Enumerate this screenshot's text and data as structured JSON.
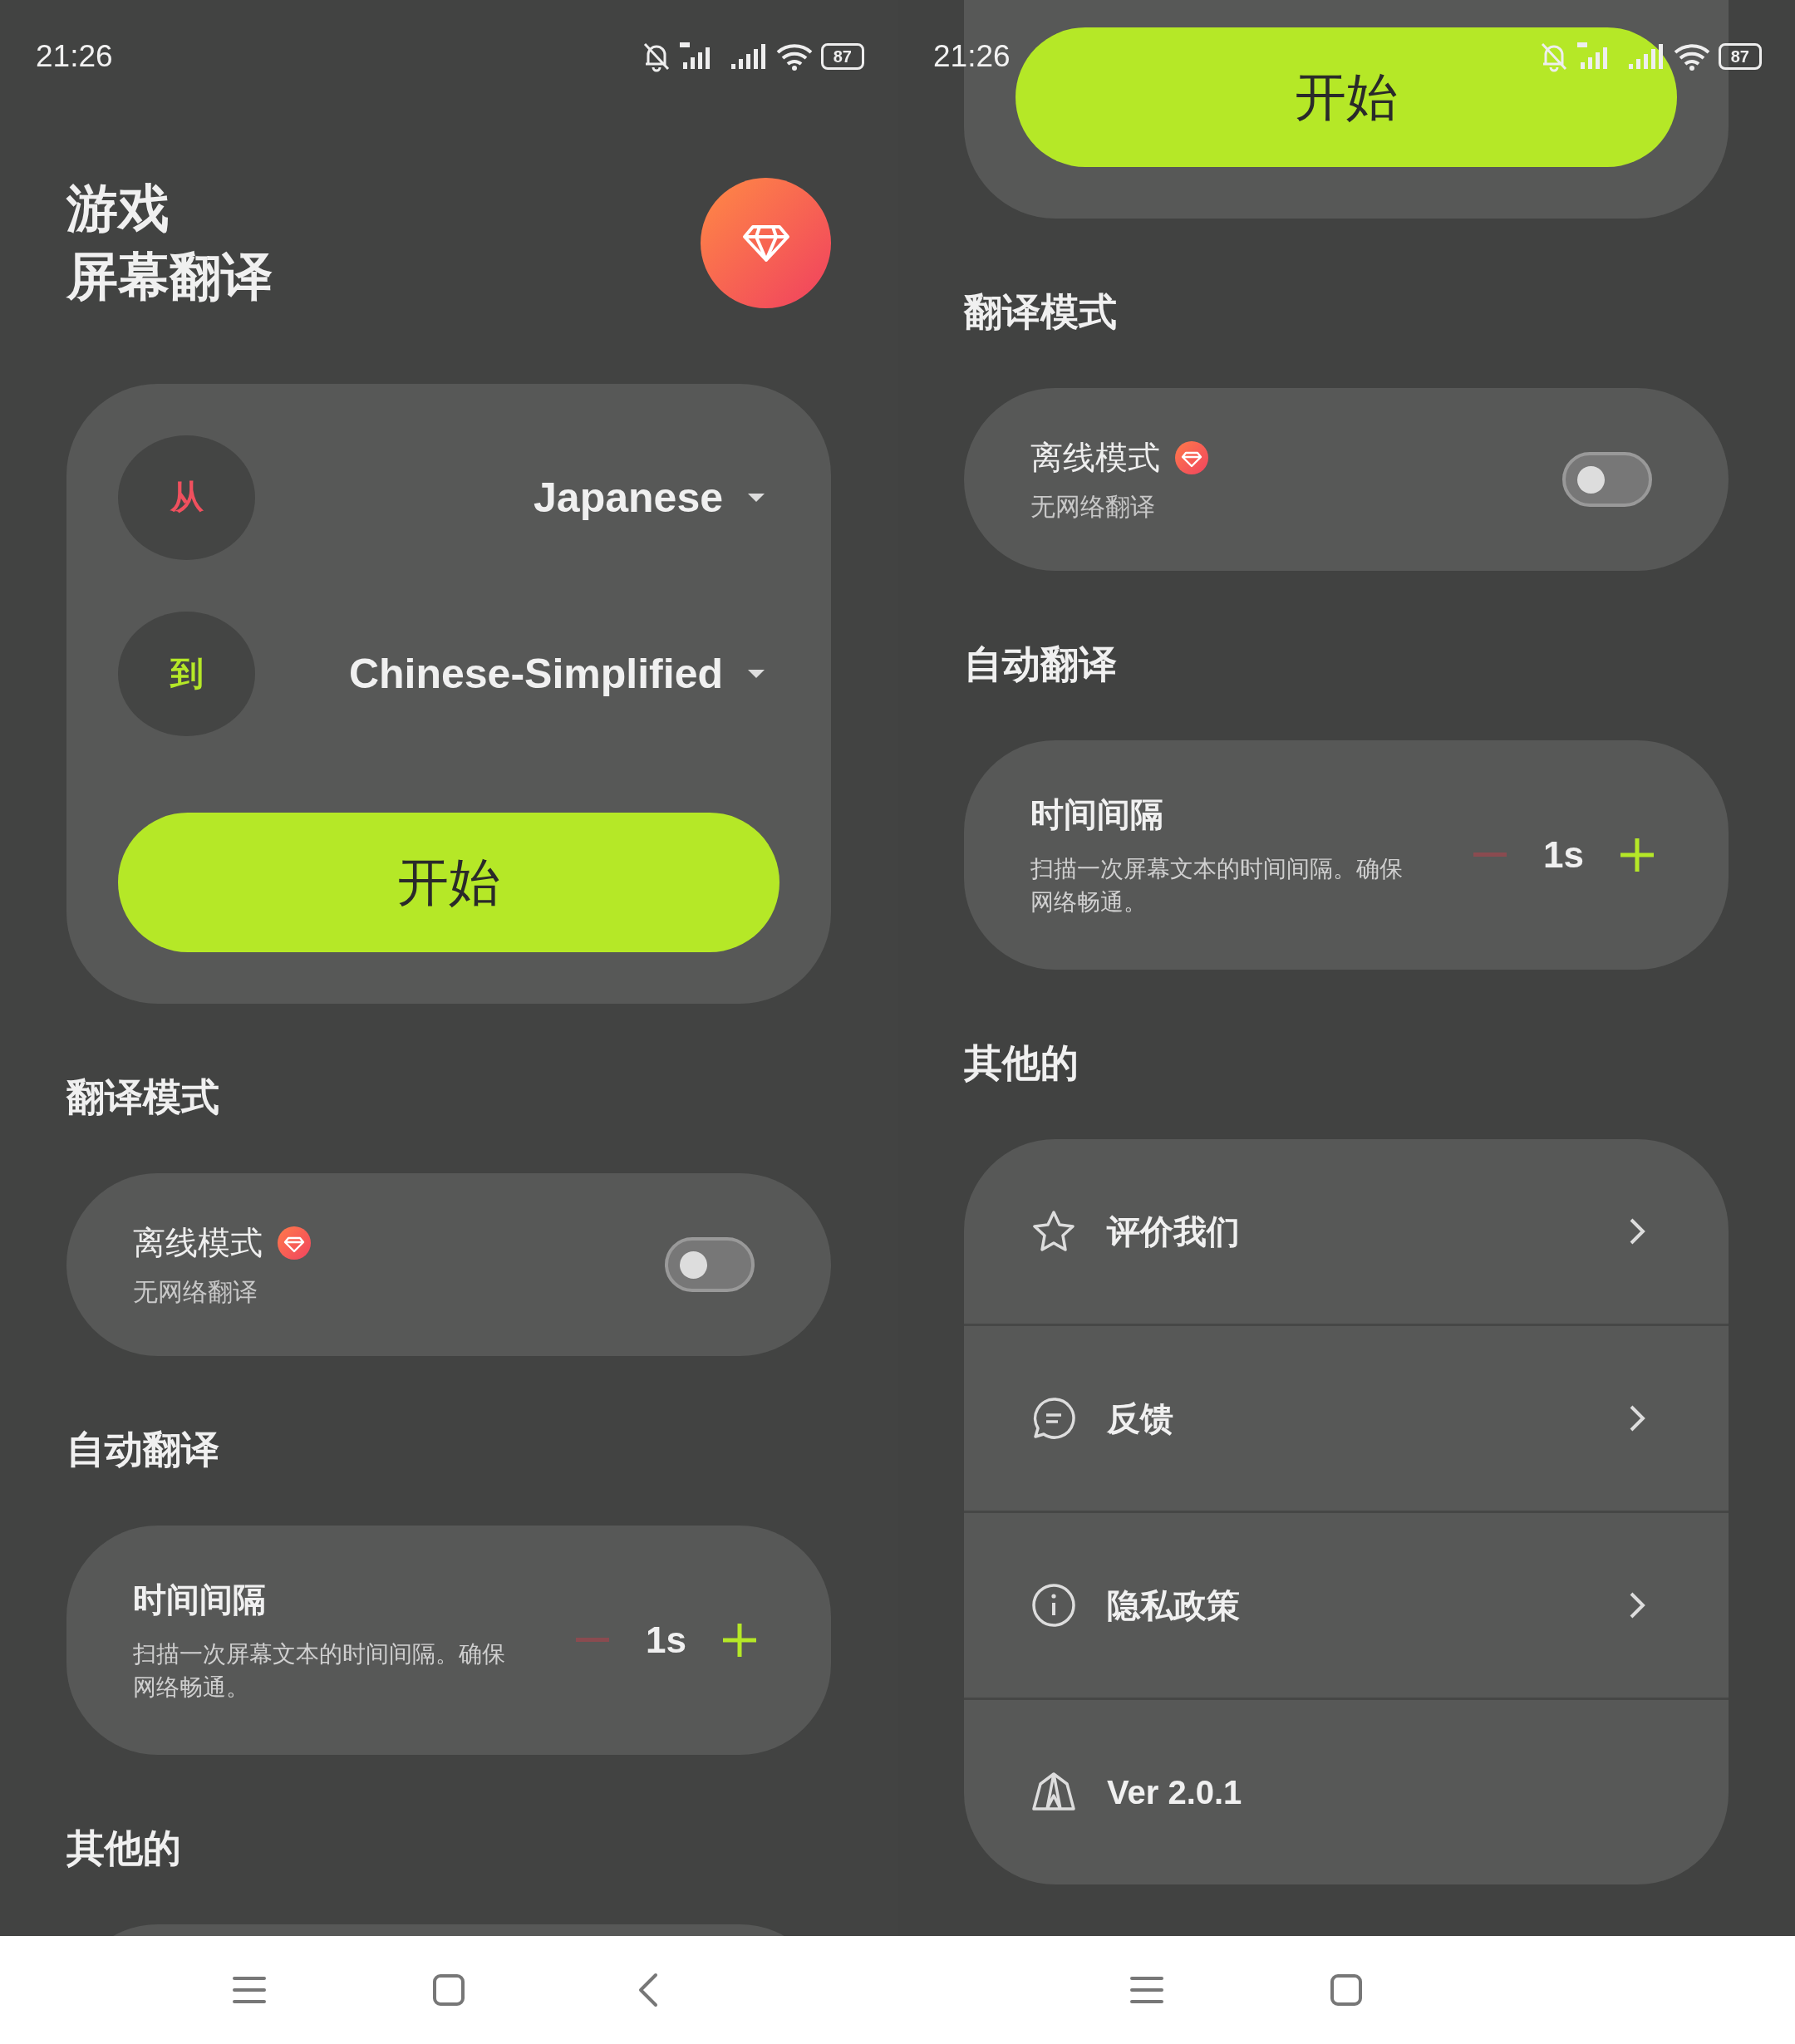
{
  "screens": [
    {
      "status_bar": {
        "time": "21:26",
        "battery": "87"
      },
      "header": {
        "title_lines": [
          "游戏",
          "屏幕翻译"
        ]
      },
      "language_card": {
        "rows": [
          {
            "kind": "from",
            "badge": "从",
            "language": "Japanese"
          },
          {
            "kind": "to",
            "badge": "到",
            "language": "Chinese-Simplified"
          }
        ],
        "start_button": "开始"
      },
      "sections": [
        {
          "title": "翻译模式",
          "kind": "toggle",
          "label": "离线模式",
          "premium": true,
          "subtitle": "无网络翻译",
          "on": false
        },
        {
          "title": "自动翻译",
          "kind": "stepper",
          "label": "时间间隔",
          "description": "扫描一次屏幕文本的时间间隔。确保网络畅通。",
          "value": "1s",
          "minus_disabled": true
        },
        {
          "title": "其他的",
          "kind": "list"
        }
      ],
      "nav_bar": [
        {
          "kind": "menu"
        },
        {
          "kind": "home"
        },
        {
          "kind": "back"
        }
      ]
    },
    {
      "status_bar": {
        "time": "21:26",
        "battery": "87"
      },
      "language_card": {
        "start_button": "开始"
      },
      "sections": [
        {
          "title": "翻译模式",
          "kind": "toggle",
          "label": "离线模式",
          "premium": true,
          "subtitle": "无网络翻译",
          "on": false
        },
        {
          "title": "自动翻译",
          "kind": "stepper",
          "label": "时间间隔",
          "description": "扫描一次屏幕文本的时间间隔。确保网络畅通。",
          "value": "1s",
          "minus_disabled": true
        },
        {
          "title": "其他的",
          "kind": "list",
          "items": [
            {
              "kind": "star",
              "label": "评价我们",
              "chevron": true
            },
            {
              "kind": "chat",
              "label": "反馈",
              "chevron": true
            },
            {
              "kind": "info",
              "label": "隐私政策",
              "chevron": true
            },
            {
              "kind": "tent",
              "label": "Ver 2.0.1",
              "chevron": false
            }
          ]
        }
      ],
      "nav_bar": [
        {
          "kind": "menu"
        },
        {
          "kind": "home"
        }
      ]
    }
  ]
}
